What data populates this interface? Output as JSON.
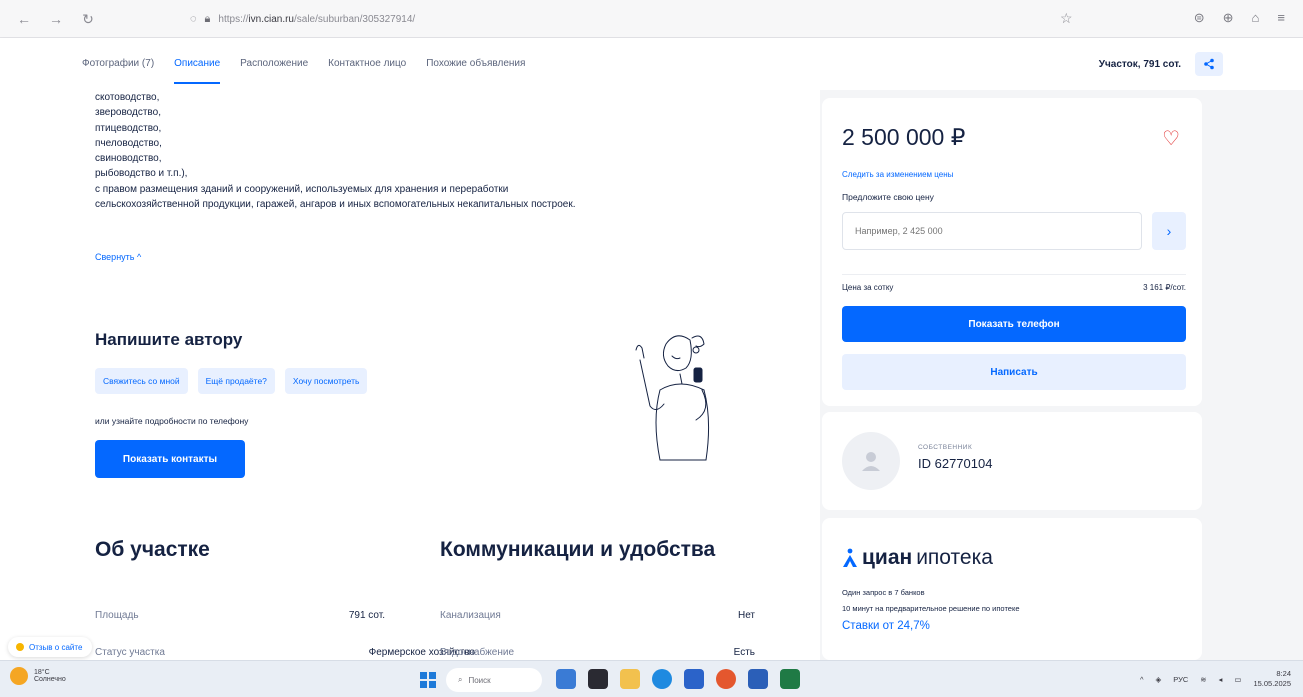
{
  "browser": {
    "url_prefix": "https://",
    "url_host": "ivn.cian.ru",
    "url_path": "/sale/suburban/305327914/",
    "icons": [
      "back-icon",
      "forward-icon",
      "reload-icon",
      "lock-icon",
      "star-icon",
      "shield-icon",
      "extensions-icon",
      "profile-icon",
      "menu-icon"
    ]
  },
  "tabs": {
    "items": [
      {
        "label": "Фотографии (7)"
      },
      {
        "label": "Описание"
      },
      {
        "label": "Расположение"
      },
      {
        "label": "Контактное лицо"
      },
      {
        "label": "Похожие объявления"
      }
    ],
    "active_index": 1,
    "summary": "Участок, 791 сот."
  },
  "description": {
    "lines": [
      "скотоводство,",
      "звероводство,",
      "птицеводство,",
      "пчеловодство,",
      "свиноводство,",
      "рыбоводство и т.п.),",
      "с правом размещения зданий и сооружений, используемых для хранения и переработки",
      "сельскохозяйственной продукции, гаражей, ангаров и иных вспомогательных некапитальных построек."
    ],
    "collapse": "Свернуть ^"
  },
  "write_author": {
    "title": "Напишите автору",
    "chips": [
      "Свяжитесь со мной",
      "Ещё продаёте?",
      "Хочу посмотреть"
    ],
    "or_phone": "или узнайте подробности по телефону",
    "button": "Показать контакты"
  },
  "plot": {
    "title": "Об участке",
    "rows": [
      {
        "label": "Площадь",
        "value": "791 сот."
      },
      {
        "label": "Статус участка",
        "value": "Фермерское хозяйство"
      }
    ]
  },
  "utilities": {
    "title": "Коммуникации и удобства",
    "rows": [
      {
        "label": "Канализация",
        "value": "Нет"
      },
      {
        "label": "Водоснабжение",
        "value": "Есть"
      }
    ]
  },
  "price_card": {
    "price": "2 500 000 ₽",
    "follow": "Следить за изменением цены",
    "offer_label": "Предложите свою цену",
    "offer_placeholder": "Например, 2 425 000",
    "per_unit_label": "Цена за сотку",
    "per_unit_value": "3 161 ₽/сот.",
    "phone_button": "Показать телефон",
    "write_button": "Написать"
  },
  "owner_card": {
    "type": "СОБСТВЕННИК",
    "id": "ID 62770104"
  },
  "mortgage_card": {
    "brand": "циан",
    "product": "ипотека",
    "line1": "Один запрос в 7 банков",
    "line2": "10 минут на предварительное решение по ипотеке",
    "rates": "Ставки от 24,7%"
  },
  "feedback": "Отзыв о сайте",
  "taskbar": {
    "weather_temp": "18°C",
    "weather_desc": "Солнечно",
    "search": "Поиск",
    "lang": "РУС",
    "time": "8:24",
    "date": "15.05.2025"
  },
  "colors": {
    "accent": "#0468ff",
    "accent_light": "#e8f0ff",
    "text": "#152242",
    "heart": "#e12e2e"
  }
}
